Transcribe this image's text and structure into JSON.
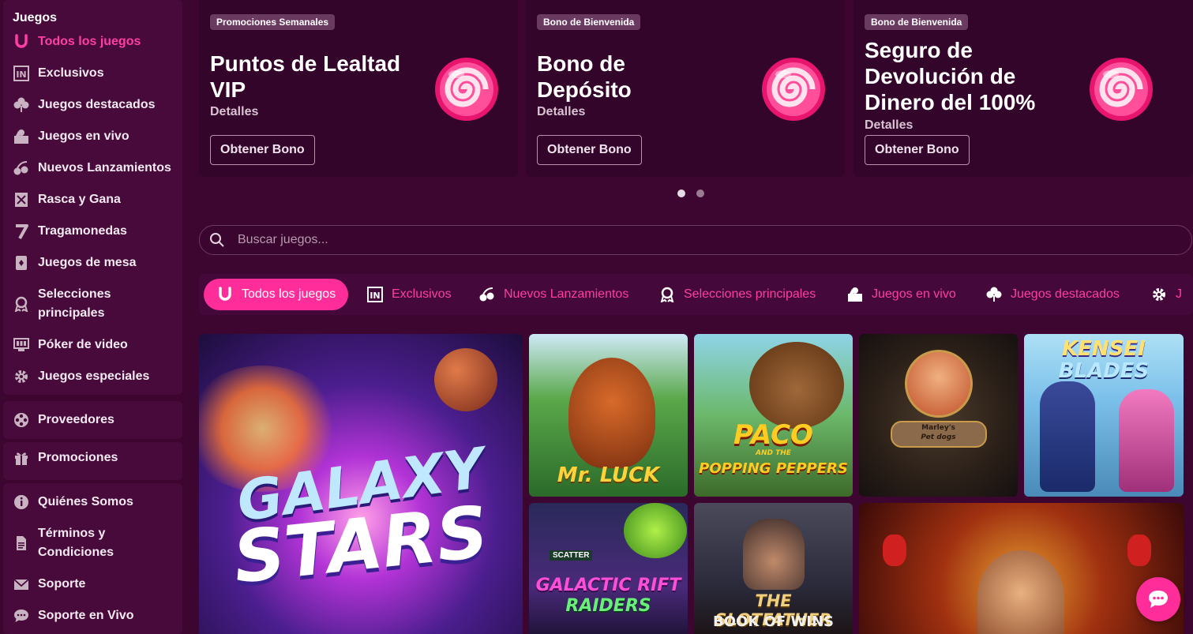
{
  "sidebar": {
    "heading": "Juegos",
    "items": [
      {
        "label": "Todos los juegos",
        "icon": "horseshoe-icon"
      },
      {
        "label": "Exclusivos",
        "icon": "in-badge-icon"
      },
      {
        "label": "Juegos destacados",
        "icon": "clover-icon"
      },
      {
        "label": "Juegos en vivo",
        "icon": "live-dealer-icon"
      },
      {
        "label": "Nuevos Lanzamientos",
        "icon": "cherries-icon"
      },
      {
        "label": "Rasca y Gana",
        "icon": "scratch-card-icon"
      },
      {
        "label": "Tragamonedas",
        "icon": "seven-icon"
      },
      {
        "label": "Juegos de mesa",
        "icon": "cards-icon"
      },
      {
        "label": "Selecciones principales",
        "icon": "award-ribbon-icon"
      },
      {
        "label": "Póker de video",
        "icon": "video-poker-icon"
      },
      {
        "label": "Juegos especiales",
        "icon": "gear-icon"
      }
    ],
    "providers": "Proveedores",
    "promotions": "Promociones",
    "info": [
      {
        "label": "Quiénes Somos",
        "icon": "info-icon"
      },
      {
        "label": "Términos y Condiciones",
        "icon": "document-icon"
      },
      {
        "label": "Soporte",
        "icon": "mail-icon"
      },
      {
        "label": "Soporte en Vivo",
        "icon": "chat-icon"
      }
    ]
  },
  "promos": [
    {
      "tag": "Promociones Semanales",
      "title": "Puntos de Lealtad VIP",
      "details": "Detalles",
      "button": "Obtener Bono"
    },
    {
      "tag": "Bono de Bienvenida",
      "title": "Bono de Depósito",
      "details": "Detalles",
      "button": "Obtener Bono"
    },
    {
      "tag": "Bono de Bienvenida",
      "title": "Seguro de Devolución de Dinero del 100%",
      "details": "Detalles",
      "button": "Obtener Bono"
    }
  ],
  "carousel": {
    "active_index": 0,
    "count": 2
  },
  "search": {
    "placeholder": "Buscar juegos..."
  },
  "tabs": [
    {
      "label": "Todos los juegos",
      "icon": "horseshoe-icon"
    },
    {
      "label": "Exclusivos",
      "icon": "in-badge-icon"
    },
    {
      "label": "Nuevos Lanzamientos",
      "icon": "cherries-icon"
    },
    {
      "label": "Selecciones principales",
      "icon": "award-ribbon-icon"
    },
    {
      "label": "Juegos en vivo",
      "icon": "live-dealer-icon"
    },
    {
      "label": "Juegos destacados",
      "icon": "clover-icon"
    },
    {
      "label": "J",
      "icon": "gear-icon"
    }
  ],
  "games": [
    {
      "title_line1": "GALAXY",
      "title_line2": "STARS"
    },
    {
      "title_line1": "Mr. LUCK",
      "title_line2": ""
    },
    {
      "title_line1": "PACO",
      "title_line2": "POPPING PEPPERS"
    },
    {
      "title_line1": "Marley's",
      "title_line2": "Pet dogs"
    },
    {
      "title_line1": "KENSEI",
      "title_line2": "BLADES"
    },
    {
      "title_line1": "GALACTIC RIFT",
      "title_line2": "RAIDERS"
    },
    {
      "title_line1": "THE SLOTFATHER",
      "title_line2": "BOOK OF WINS"
    },
    {
      "title_line1": "",
      "title_line2": ""
    }
  ],
  "scatter_label": "SCATTER",
  "paco_small": "AND THE",
  "colors": {
    "accent": "#ff2d9a",
    "background": "#3d0631",
    "panel": "#470a3a"
  }
}
